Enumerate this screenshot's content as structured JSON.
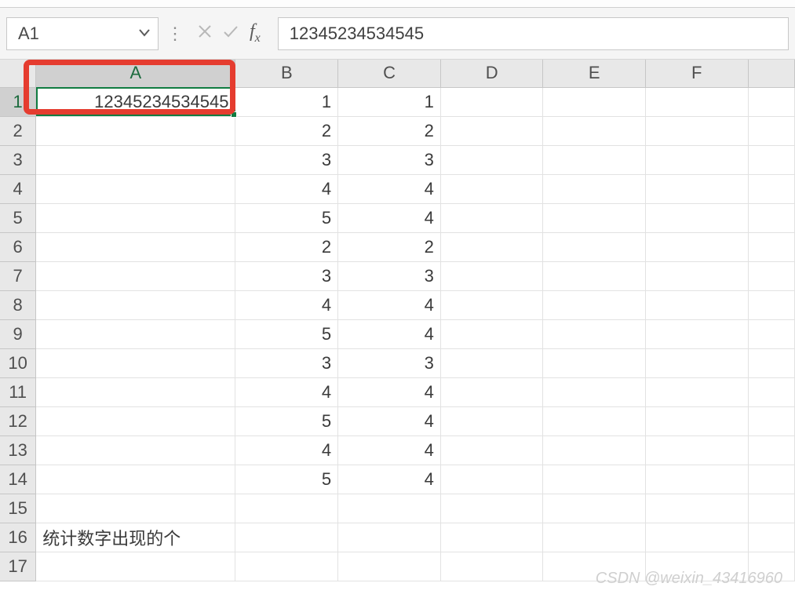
{
  "namebox": {
    "value": "A1"
  },
  "formula_bar": {
    "value": "12345234534545"
  },
  "columns": [
    "A",
    "B",
    "C",
    "D",
    "E",
    "F"
  ],
  "active_col": "A",
  "active_row": 1,
  "row_count": 17,
  "cells": {
    "A1": "12345234534545",
    "B1": "1",
    "C1": "1",
    "B2": "2",
    "C2": "2",
    "B3": "3",
    "C3": "3",
    "B4": "4",
    "C4": "4",
    "B5": "5",
    "C5": "4",
    "B6": "2",
    "C6": "2",
    "B7": "3",
    "C7": "3",
    "B8": "4",
    "C8": "4",
    "B9": "5",
    "C9": "4",
    "B10": "3",
    "C10": "3",
    "B11": "4",
    "C11": "4",
    "B12": "5",
    "C12": "4",
    "B13": "4",
    "C13": "4",
    "B14": "5",
    "C14": "4",
    "A16": "统计数字出现的个"
  },
  "text_cells": [
    "A16"
  ],
  "watermark": "CSDN @weixin_43416960",
  "highlight": {
    "cell": "A1"
  }
}
